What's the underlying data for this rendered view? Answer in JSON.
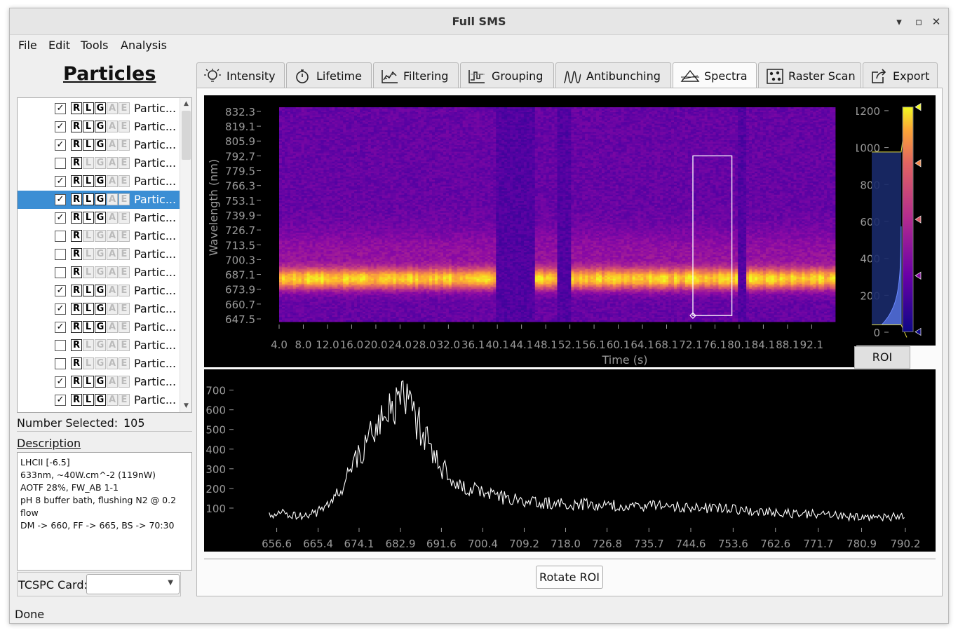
{
  "window": {
    "title": "Full SMS",
    "minimize_glyph": "▾",
    "maximize_glyph": "▫",
    "close_glyph": "✕"
  },
  "menu": [
    "File",
    "Edit",
    "Tools",
    "Analysis"
  ],
  "left_panel": {
    "title": "Particles",
    "tag_letters": [
      "R",
      "L",
      "G",
      "A",
      "E"
    ],
    "particles": [
      {
        "name": "Partic...",
        "checked": true,
        "active": [
          true,
          true,
          true,
          false,
          false
        ],
        "selected": false
      },
      {
        "name": "Partic...",
        "checked": true,
        "active": [
          true,
          true,
          true,
          false,
          false
        ],
        "selected": false
      },
      {
        "name": "Partic...",
        "checked": true,
        "active": [
          true,
          true,
          true,
          false,
          false
        ],
        "selected": false
      },
      {
        "name": "Partic...",
        "checked": false,
        "active": [
          true,
          false,
          false,
          false,
          false
        ],
        "selected": false
      },
      {
        "name": "Partic...",
        "checked": true,
        "active": [
          true,
          true,
          true,
          false,
          false
        ],
        "selected": false
      },
      {
        "name": "Partic...",
        "checked": true,
        "active": [
          true,
          true,
          true,
          false,
          false
        ],
        "selected": true
      },
      {
        "name": "Partic...",
        "checked": true,
        "active": [
          true,
          true,
          true,
          false,
          false
        ],
        "selected": false
      },
      {
        "name": "Partic...",
        "checked": false,
        "active": [
          true,
          false,
          false,
          false,
          false
        ],
        "selected": false
      },
      {
        "name": "Partic...",
        "checked": false,
        "active": [
          true,
          false,
          false,
          false,
          false
        ],
        "selected": false
      },
      {
        "name": "Partic...",
        "checked": false,
        "active": [
          true,
          false,
          false,
          false,
          false
        ],
        "selected": false
      },
      {
        "name": "Partic...",
        "checked": true,
        "active": [
          true,
          true,
          true,
          false,
          false
        ],
        "selected": false
      },
      {
        "name": "Partic...",
        "checked": true,
        "active": [
          true,
          true,
          true,
          false,
          false
        ],
        "selected": false
      },
      {
        "name": "Partic...",
        "checked": true,
        "active": [
          true,
          true,
          true,
          false,
          false
        ],
        "selected": false
      },
      {
        "name": "Partic...",
        "checked": false,
        "active": [
          true,
          false,
          false,
          false,
          false
        ],
        "selected": false
      },
      {
        "name": "Partic...",
        "checked": false,
        "active": [
          true,
          false,
          false,
          false,
          false
        ],
        "selected": false
      },
      {
        "name": "Partic...",
        "checked": true,
        "active": [
          true,
          true,
          true,
          false,
          false
        ],
        "selected": false
      },
      {
        "name": "Partic...",
        "checked": true,
        "active": [
          true,
          true,
          true,
          false,
          false
        ],
        "selected": false
      }
    ],
    "number_selected_label": "Number Selected:",
    "number_selected_value": "105",
    "description_title": "Description",
    "description_lines": [
      "LHCII [-6.5]",
      "633nm, ~40W.cm^-2 (119nW)",
      "AOTF 28%, FW_AB 1-1",
      "pH 8 buffer bath, flushing N2 @ 0.2",
      "flow",
      "DM -> 660, FF -> 665, BS -> 70:30"
    ],
    "tcspc_label": "TCSPC Card:",
    "tcspc_value": ""
  },
  "tabs": [
    {
      "label": "Intensity",
      "icon": "lightbulb-icon",
      "active": false
    },
    {
      "label": "Lifetime",
      "icon": "stopwatch-icon",
      "active": false
    },
    {
      "label": "Filtering",
      "icon": "filter-chart-icon",
      "active": false
    },
    {
      "label": "Grouping",
      "icon": "grouping-icon",
      "active": false
    },
    {
      "label": "Antibunching",
      "icon": "antibunching-icon",
      "active": false
    },
    {
      "label": "Spectra",
      "icon": "spectra-icon",
      "active": true
    },
    {
      "label": "Raster Scan",
      "icon": "raster-scan-icon",
      "active": false
    },
    {
      "label": "Export",
      "icon": "export-icon",
      "active": false
    }
  ],
  "spectra": {
    "roi_button": "ROI",
    "rotate_button": "Rotate ROI",
    "roi_time_range": [
      72.1,
      78.9
    ],
    "roi_wavelength_range": [
      650.5,
      792.7
    ],
    "colors": {
      "background": "#000000",
      "axis_text": "#9a9a9a",
      "trace": "#ffffff",
      "roi": "#ffffff"
    }
  },
  "chart_data": [
    {
      "type": "heatmap",
      "title": "",
      "xlabel": "Time (s)",
      "ylabel": "Wavelength (nm)",
      "x_ticks": [
        "4.0",
        "8.0",
        "12.0",
        "16.0",
        "20.0",
        "24.0",
        "28.0",
        "32.0",
        "36.1",
        "40.1",
        "44.1",
        "48.1",
        "52.1",
        "56.1",
        "60.1",
        "64.1",
        "68.1",
        "72.1",
        "76.1",
        "80.1",
        "84.1",
        "88.1",
        "92.1"
      ],
      "y_ticks": [
        "832.3",
        "819.1",
        "805.9",
        "792.7",
        "779.5",
        "766.3",
        "753.1",
        "739.9",
        "726.7",
        "713.5",
        "700.3",
        "687.1",
        "673.9",
        "660.7",
        "647.5"
      ],
      "xlim": [
        4.0,
        96.0
      ],
      "ylim": [
        645.0,
        836.0
      ],
      "peak_wavelength": 683,
      "dark_intervals": [
        [
          40.0,
          44.1
        ],
        [
          44.1,
          46.1
        ],
        [
          50.1,
          52.1
        ],
        [
          80.1,
          81.1
        ]
      ],
      "colormap": "plasma"
    },
    {
      "type": "histogram",
      "title": "",
      "y_ticks": [
        "0",
        "200",
        "400",
        "600",
        "800",
        "1000",
        "1200"
      ],
      "ylim": [
        0,
        1230
      ],
      "level_min": 40,
      "level_max": 1220,
      "colormap": "plasma"
    },
    {
      "type": "line",
      "title": "",
      "xlabel": "",
      "ylabel": "",
      "x_ticks": [
        "656.6",
        "665.4",
        "674.1",
        "682.9",
        "691.6",
        "700.4",
        "709.2",
        "718.0",
        "726.8",
        "735.7",
        "744.6",
        "753.6",
        "762.6",
        "771.7",
        "780.9",
        "790.2"
      ],
      "y_ticks": [
        "100",
        "200",
        "300",
        "400",
        "500",
        "600",
        "700"
      ],
      "xlim": [
        651.0,
        792.0
      ],
      "ylim": [
        0,
        770
      ],
      "series": [
        {
          "x": [
            655,
            658,
            661,
            664,
            667,
            670,
            672,
            674,
            676,
            678,
            680,
            682,
            683,
            684,
            686,
            688,
            690,
            692,
            694,
            697,
            700,
            703,
            706,
            709,
            712,
            716,
            720,
            725,
            730,
            735,
            740,
            745,
            750,
            755,
            760,
            765,
            770,
            775,
            780,
            785,
            790
          ],
          "y": [
            60,
            80,
            55,
            70,
            100,
            180,
            280,
            370,
            440,
            520,
            580,
            650,
            690,
            640,
            560,
            470,
            380,
            300,
            250,
            210,
            180,
            160,
            150,
            140,
            130,
            125,
            120,
            115,
            112,
            110,
            108,
            105,
            98,
            90,
            80,
            75,
            70,
            62,
            55,
            52,
            58
          ]
        }
      ]
    }
  ]
}
